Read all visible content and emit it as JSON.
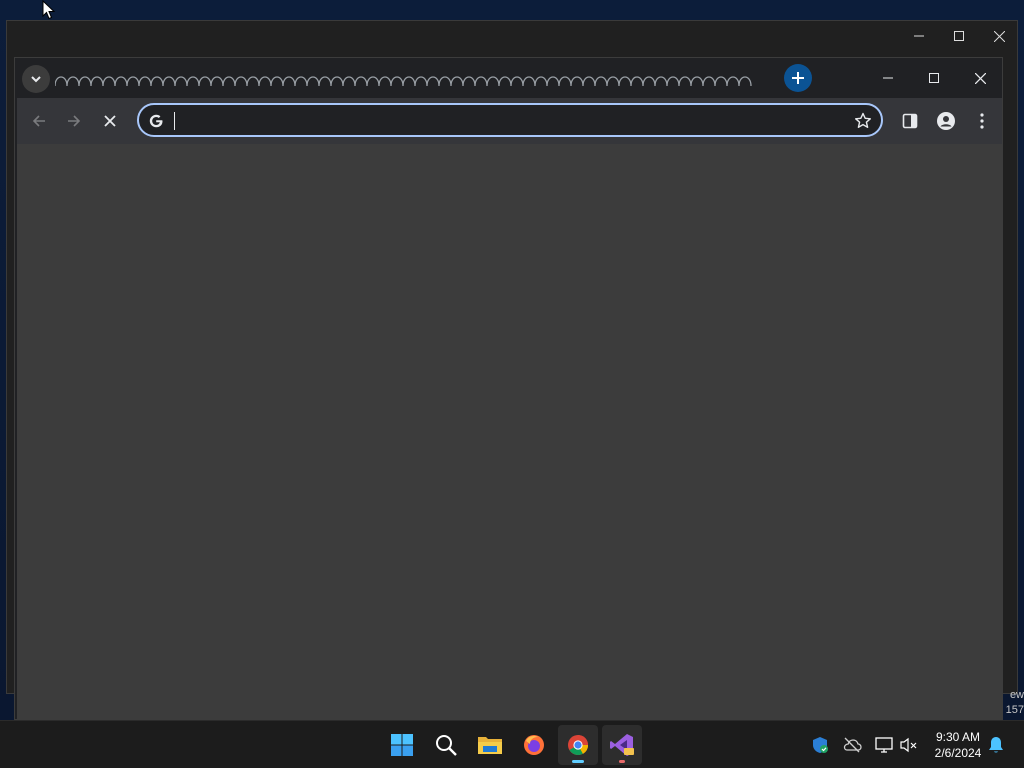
{
  "browser": {
    "omnibox": {
      "value": "",
      "placeholder": ""
    },
    "icons": {
      "tab_search": "chevron-down-icon",
      "new_tab": "plus-icon",
      "back": "arrow-left-icon",
      "forward": "arrow-right-icon",
      "stop": "close-icon",
      "google": "google-g-icon",
      "bookmark": "star-icon",
      "side_panel": "side-panel-icon",
      "profile": "profile-icon",
      "menu": "kebab-menu-icon"
    },
    "colors": {
      "frame": "#202124",
      "toolbar": "#35363a",
      "content": "#3c3c3c",
      "omnibox_focus": "#a8c7fa",
      "new_tab_button": "#0b5394"
    }
  },
  "taskbar": {
    "apps": [
      "Start",
      "Search",
      "File Explorer",
      "Firefox",
      "Google Chrome",
      "Visual Studio Preview"
    ],
    "clock": {
      "time": "9:30 AM",
      "date": "2/6/2024"
    },
    "side_text": [
      "ew",
      "157"
    ]
  }
}
